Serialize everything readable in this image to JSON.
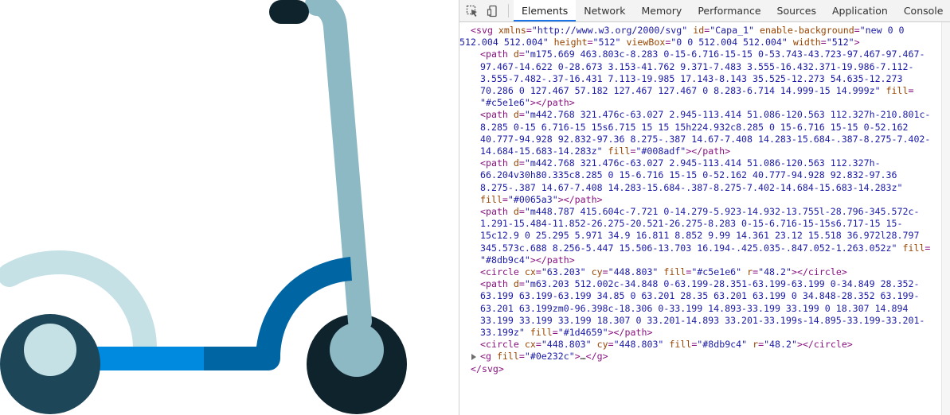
{
  "devtools": {
    "tabs": [
      {
        "label": "Elements",
        "active": true
      },
      {
        "label": "Network",
        "active": false
      },
      {
        "label": "Memory",
        "active": false
      },
      {
        "label": "Performance",
        "active": false
      },
      {
        "label": "Sources",
        "active": false
      },
      {
        "label": "Application",
        "active": false
      },
      {
        "label": "Console",
        "active": false
      },
      {
        "label": "Se",
        "active": false
      }
    ],
    "tool_icons": [
      "inspect-element-icon",
      "device-toolbar-icon"
    ]
  },
  "colors": {
    "light_grey_blue": "#c5e1e6",
    "bright_blue": "#008adf",
    "dark_blue": "#0065a3",
    "steel_blue": "#8db9c4",
    "navy": "#1d4659",
    "near_black": "#0e232c"
  },
  "svg_source": {
    "line1": "<svg xmlns=\"http://www.w3.org/2000/svg\" id=\"Capa_1\" enable-background=\"new 0 0",
    "line2": "512.004 512.004\" height=\"512\" viewBox=\"0 0 512.004 512.004\" width=\"512\">",
    "path1": [
      "<path d=\"m175.669 463.803c-8.283 0-15-6.716-15-15 0-53.743-43.723-97.467-97.467-",
      "97.467-14.622 0-28.673 3.153-41.762 9.371-7.483 3.555-16.432.371-19.986-7.112-",
      "3.555-7.482-.37-16.431 7.113-19.985 17.143-8.143 35.525-12.273 54.635-12.273",
      "70.286 0 127.467 57.182 127.467 127.467 0 8.283-6.714 14.999-15 14.999z\" fill=",
      "\"#c5e1e6\"></path>"
    ],
    "path2": [
      "<path d=\"m442.768 321.476c-63.027 2.945-113.414 51.086-120.563 112.327h-210.801c-",
      "8.285 0-15 6.716-15 15s6.715 15 15 15h224.932c8.285 0 15-6.716 15-15 0-52.162",
      "40.777-94.928 92.832-97.36 8.275-.387 14.67-7.408 14.283-15.684-.387-8.275-7.402-",
      "14.684-15.683-14.283z\" fill=\"#008adf\"></path>"
    ],
    "path3": [
      "<path d=\"m442.768 321.476c-63.027 2.945-113.414 51.086-120.563 112.327h-",
      "66.204v30h80.335c8.285 0 15-6.716 15-15 0-52.162 40.777-94.928 92.832-97.36",
      "8.275-.387 14.67-7.408 14.283-15.684-.387-8.275-7.402-14.684-15.683-14.283z\"",
      "fill=\"#0065a3\"></path>"
    ],
    "path4": [
      "<path d=\"m448.787 415.604c-7.721 0-14.279-5.923-14.932-13.755l-28.796-345.572c-",
      "1.291-15.484-11.852-26.275-20.521-26.275-8.283 0-15-6.716-15-15s6.717-15 15-",
      "15c12.9 0 25.295 5.971 34.9 16.811 8.852 9.99 14.361 23.12 15.518 36.972l28.797",
      "345.573c.688 8.256-5.447 15.506-13.703 16.194-.425.035-.847.052-1.263.052z\" fill=",
      "\"#8db9c4\"></path>"
    ],
    "circle1": "<circle cx=\"63.203\" cy=\"448.803\" fill=\"#c5e1e6\" r=\"48.2\"></circle>",
    "path5": [
      "<path d=\"m63.203 512.002c-34.848 0-63.199-28.351-63.199-63.199 0-34.849 28.352-",
      "63.199 63.199-63.199 34.85 0 63.201 28.35 63.201 63.199 0 34.848-28.352 63.199-",
      "63.201 63.199zm0-96.398c-18.306 0-33.199 14.893-33.199 33.199 0 18.307 14.894",
      "33.199 33.199 33.199 18.307 0 33.201-14.893 33.201-33.199s-14.895-33.199-33.201-",
      "33.199z\" fill=\"#1d4659\"></path>"
    ],
    "circle2": "<circle cx=\"448.803\" cy=\"448.803\" fill=\"#8db9c4\" r=\"48.2\"></circle>",
    "g_line": "<g fill=\"#0e232c\">…</g>",
    "close": "</svg>"
  }
}
